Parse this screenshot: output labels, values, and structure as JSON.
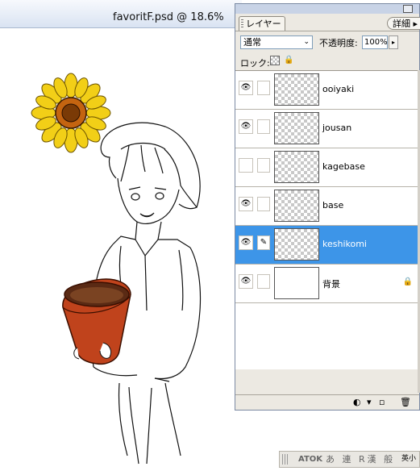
{
  "document": {
    "title": "favoritF.psd @ 18.6%"
  },
  "panel": {
    "tab_label": "レイヤー",
    "detail_label": "詳細",
    "blend_mode": "通常",
    "opacity_label": "不透明度:",
    "opacity_value": "100%",
    "lock_label": "ロック:",
    "layers": [
      {
        "name": "ooiyaki",
        "visible": true,
        "selected": false
      },
      {
        "name": "jousan",
        "visible": true,
        "selected": false
      },
      {
        "name": "kagebase",
        "visible": false,
        "selected": false
      },
      {
        "name": "base",
        "visible": true,
        "selected": false
      },
      {
        "name": "keshikomi",
        "visible": true,
        "selected": true
      },
      {
        "name": "背景",
        "visible": true,
        "selected": false,
        "locked": true
      }
    ]
  },
  "taskbar": {
    "ime": "ATOK",
    "items": "あ 連 R漢 般",
    "small": "英小"
  },
  "colors": {
    "selection": "#3d95e8",
    "panel_bg": "#ece9e2"
  }
}
